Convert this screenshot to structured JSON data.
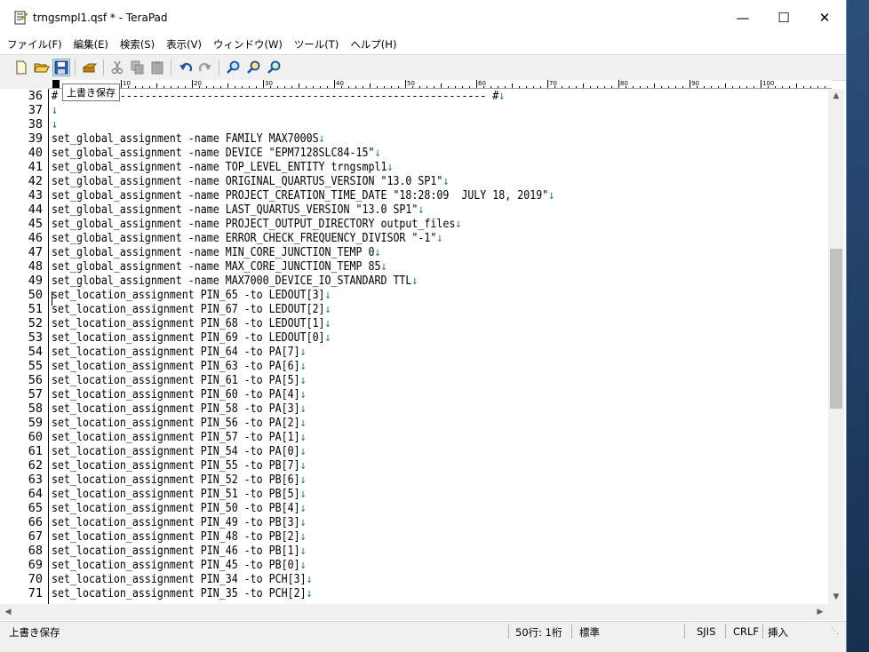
{
  "window": {
    "title": "trngsmpl1.qsf * - TeraPad"
  },
  "menu": [
    "ファイル(F)",
    "編集(E)",
    "検索(S)",
    "表示(V)",
    "ウィンドウ(W)",
    "ツール(T)",
    "ヘルプ(H)"
  ],
  "tooltip": "上書き保存",
  "ruler": [
    "10",
    "20",
    "30",
    "40",
    "50",
    "60",
    "70",
    "80",
    "90",
    "100"
  ],
  "lines": [
    {
      "n": "36",
      "t": "# ",
      "e": "↓"
    },
    {
      "n": "37",
      "t": "",
      "e": "↓"
    },
    {
      "n": "38",
      "t": "",
      "e": "↓"
    },
    {
      "n": "39",
      "t": "set_global_assignment -name FAMILY MAX7000S",
      "e": "↓"
    },
    {
      "n": "40",
      "t": "set_global_assignment -name DEVICE \"EPM7128SLC84-15\"",
      "e": "↓"
    },
    {
      "n": "41",
      "t": "set_global_assignment -name TOP_LEVEL_ENTITY trngsmpl1",
      "e": "↓"
    },
    {
      "n": "42",
      "t": "set_global_assignment -name ORIGINAL_QUARTUS_VERSION \"13.0 SP1\"",
      "e": "↓"
    },
    {
      "n": "43",
      "t": "set_global_assignment -name PROJECT_CREATION_TIME_DATE \"18:28:09  JULY 18, 2019\"",
      "e": "↓"
    },
    {
      "n": "44",
      "t": "set_global_assignment -name LAST_QUARTUS_VERSION \"13.0 SP1\"",
      "e": "↓"
    },
    {
      "n": "45",
      "t": "set_global_assignment -name PROJECT_OUTPUT_DIRECTORY output_files",
      "e": "↓"
    },
    {
      "n": "46",
      "t": "set_global_assignment -name ERROR_CHECK_FREQUENCY_DIVISOR \"-1\"",
      "e": "↓"
    },
    {
      "n": "47",
      "t": "set_global_assignment -name MIN_CORE_JUNCTION_TEMP 0",
      "e": "↓"
    },
    {
      "n": "48",
      "t": "set_global_assignment -name MAX_CORE_JUNCTION_TEMP 85",
      "e": "↓"
    },
    {
      "n": "49",
      "t": "set_global_assignment -name MAX7000_DEVICE_IO_STANDARD TTL",
      "e": "↓"
    },
    {
      "n": "50",
      "t": "set_location_assignment PIN_65 -to LEDOUT[3]",
      "e": "↓"
    },
    {
      "n": "51",
      "t": "set_location_assignment PIN_67 -to LEDOUT[2]",
      "e": "↓"
    },
    {
      "n": "52",
      "t": "set_location_assignment PIN_68 -to LEDOUT[1]",
      "e": "↓"
    },
    {
      "n": "53",
      "t": "set_location_assignment PIN_69 -to LEDOUT[0]",
      "e": "↓"
    },
    {
      "n": "54",
      "t": "set_location_assignment PIN_64 -to PA[7]",
      "e": "↓"
    },
    {
      "n": "55",
      "t": "set_location_assignment PIN_63 -to PA[6]",
      "e": "↓"
    },
    {
      "n": "56",
      "t": "set_location_assignment PIN_61 -to PA[5]",
      "e": "↓"
    },
    {
      "n": "57",
      "t": "set_location_assignment PIN_60 -to PA[4]",
      "e": "↓"
    },
    {
      "n": "58",
      "t": "set_location_assignment PIN_58 -to PA[3]",
      "e": "↓"
    },
    {
      "n": "59",
      "t": "set_location_assignment PIN_56 -to PA[2]",
      "e": "↓"
    },
    {
      "n": "60",
      "t": "set_location_assignment PIN_57 -to PA[1]",
      "e": "↓"
    },
    {
      "n": "61",
      "t": "set_location_assignment PIN_54 -to PA[0]",
      "e": "↓"
    },
    {
      "n": "62",
      "t": "set_location_assignment PIN_55 -to PB[7]",
      "e": "↓"
    },
    {
      "n": "63",
      "t": "set_location_assignment PIN_52 -to PB[6]",
      "e": "↓"
    },
    {
      "n": "64",
      "t": "set_location_assignment PIN_51 -to PB[5]",
      "e": "↓"
    },
    {
      "n": "65",
      "t": "set_location_assignment PIN_50 -to PB[4]",
      "e": "↓"
    },
    {
      "n": "66",
      "t": "set_location_assignment PIN_49 -to PB[3]",
      "e": "↓"
    },
    {
      "n": "67",
      "t": "set_location_assignment PIN_48 -to PB[2]",
      "e": "↓"
    },
    {
      "n": "68",
      "t": "set_location_assignment PIN_46 -to PB[1]",
      "e": "↓"
    },
    {
      "n": "69",
      "t": "set_location_assignment PIN_45 -to PB[0]",
      "e": "↓"
    },
    {
      "n": "70",
      "t": "set_location_assignment PIN_34 -to PCH[3]",
      "e": "↓"
    },
    {
      "n": "71",
      "t": "set_location_assignment PIN_35 -to PCH[2]",
      "e": "↓"
    }
  ],
  "line36_tail": "-------------------------------------------------------------------- #",
  "status": {
    "message": "上書き保存",
    "position": "50行:  1桁",
    "mode": "標準",
    "encoding": "SJIS",
    "newline": "CRLF",
    "insert": "挿入"
  },
  "colors": {
    "eol_marker": "#1e7a8c",
    "toolbar_bg": "#f0f0f0"
  }
}
